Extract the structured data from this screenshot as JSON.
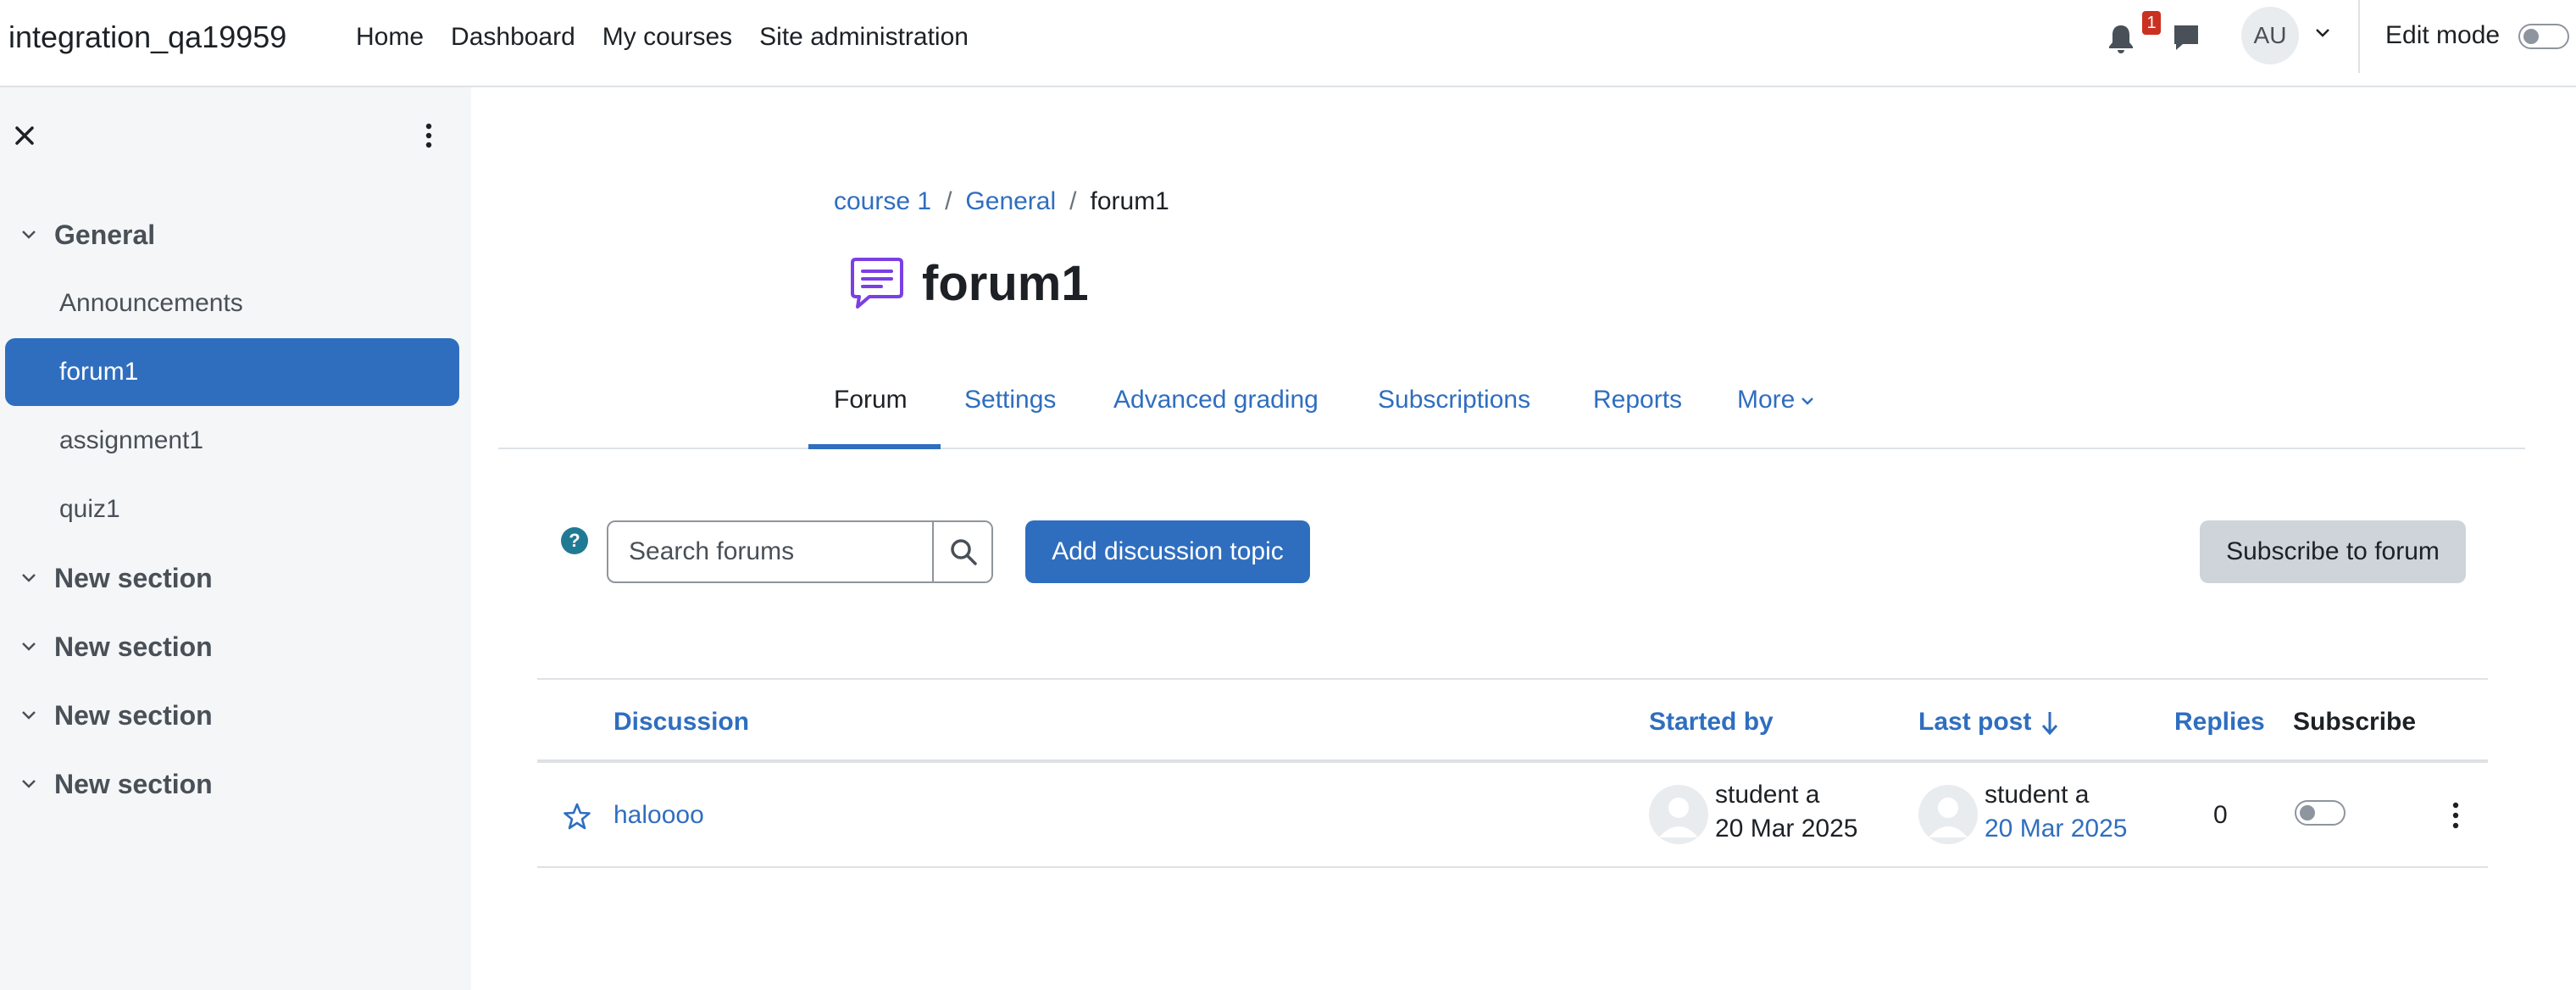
{
  "site": {
    "name": "integration_qa19959"
  },
  "primary_nav": [
    "Home",
    "Dashboard",
    "My courses",
    "Site administration"
  ],
  "header": {
    "notification_count": "1",
    "user_initials": "AU",
    "edit_mode_label": "Edit mode"
  },
  "course_index": {
    "items": [
      {
        "type": "section",
        "label": "General"
      },
      {
        "type": "item",
        "label": "Announcements"
      },
      {
        "type": "item",
        "label": "forum1",
        "active": true
      },
      {
        "type": "item",
        "label": "assignment1"
      },
      {
        "type": "item",
        "label": "quiz1"
      },
      {
        "type": "section",
        "label": "New section"
      },
      {
        "type": "section",
        "label": "New section"
      },
      {
        "type": "section",
        "label": "New section"
      },
      {
        "type": "section",
        "label": "New section"
      }
    ]
  },
  "breadcrumb": [
    "course 1",
    "General",
    "forum1"
  ],
  "page": {
    "title": "forum1"
  },
  "tabs": [
    "Forum",
    "Settings",
    "Advanced grading",
    "Subscriptions",
    "Reports",
    "More"
  ],
  "toolbar": {
    "search_placeholder": "Search forums",
    "add_topic_label": "Add discussion topic",
    "subscribe_label": "Subscribe to forum",
    "help_symbol": "?"
  },
  "table": {
    "headers": {
      "discussion": "Discussion",
      "started_by": "Started by",
      "last_post": "Last post",
      "replies": "Replies",
      "subscribe": "Subscribe"
    },
    "rows": [
      {
        "discussion": "haloooo",
        "started_by": "student a",
        "started_date": "20 Mar 2025",
        "last_post_by": "student a",
        "last_post_date": "20 Mar 2025",
        "replies": "0"
      }
    ]
  },
  "colors": {
    "primary": "#2f6ebf",
    "drawer_bg": "#f5f6f8",
    "badge": "#ca3120",
    "help": "#217a94",
    "forum_icon": "#7b3fe4"
  }
}
